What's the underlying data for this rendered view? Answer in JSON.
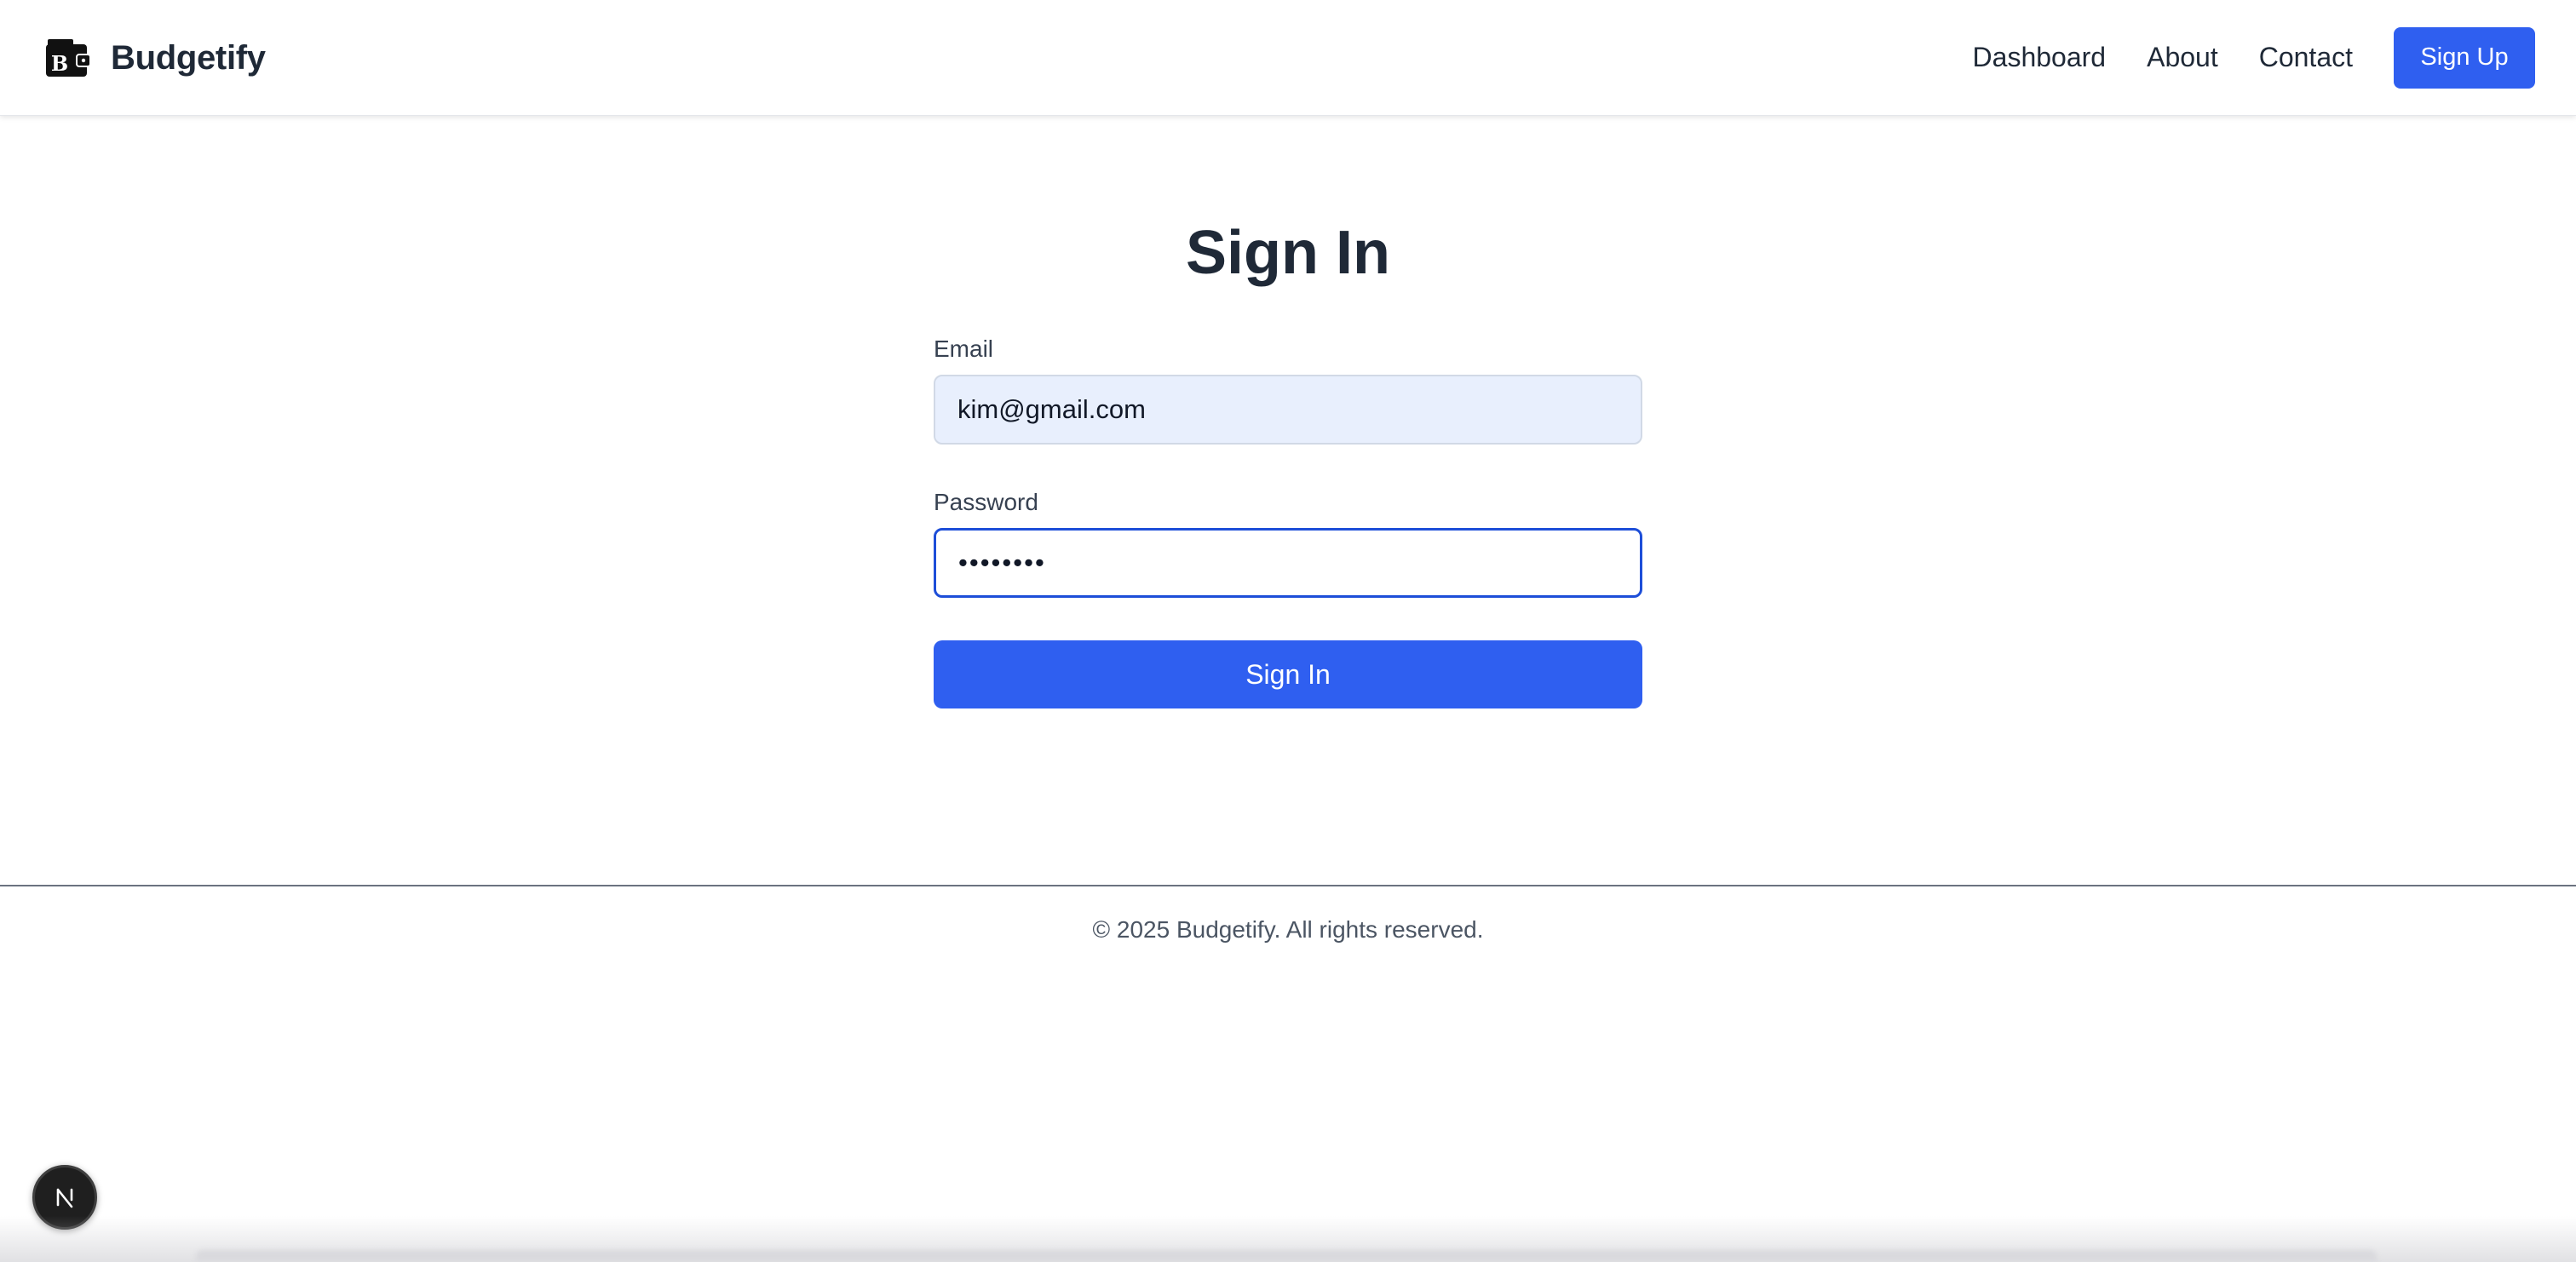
{
  "header": {
    "brand_name": "Budgetify",
    "logo_icon": "wallet-b-icon",
    "nav": [
      {
        "label": "Dashboard"
      },
      {
        "label": "About"
      },
      {
        "label": "Contact"
      }
    ],
    "signup_label": "Sign Up"
  },
  "form": {
    "title": "Sign In",
    "email_label": "Email",
    "email_value": "kim@gmail.com",
    "password_label": "Password",
    "password_value": "password",
    "submit_label": "Sign In"
  },
  "footer": {
    "copyright": "© 2025 Budgetify. All rights reserved."
  },
  "dev_badge": {
    "letter": "N"
  },
  "colors": {
    "accent": "#2f5ff0",
    "focus_border": "#1d4ed8",
    "autofill_bg": "#e8effd",
    "text": "#1f2937"
  }
}
